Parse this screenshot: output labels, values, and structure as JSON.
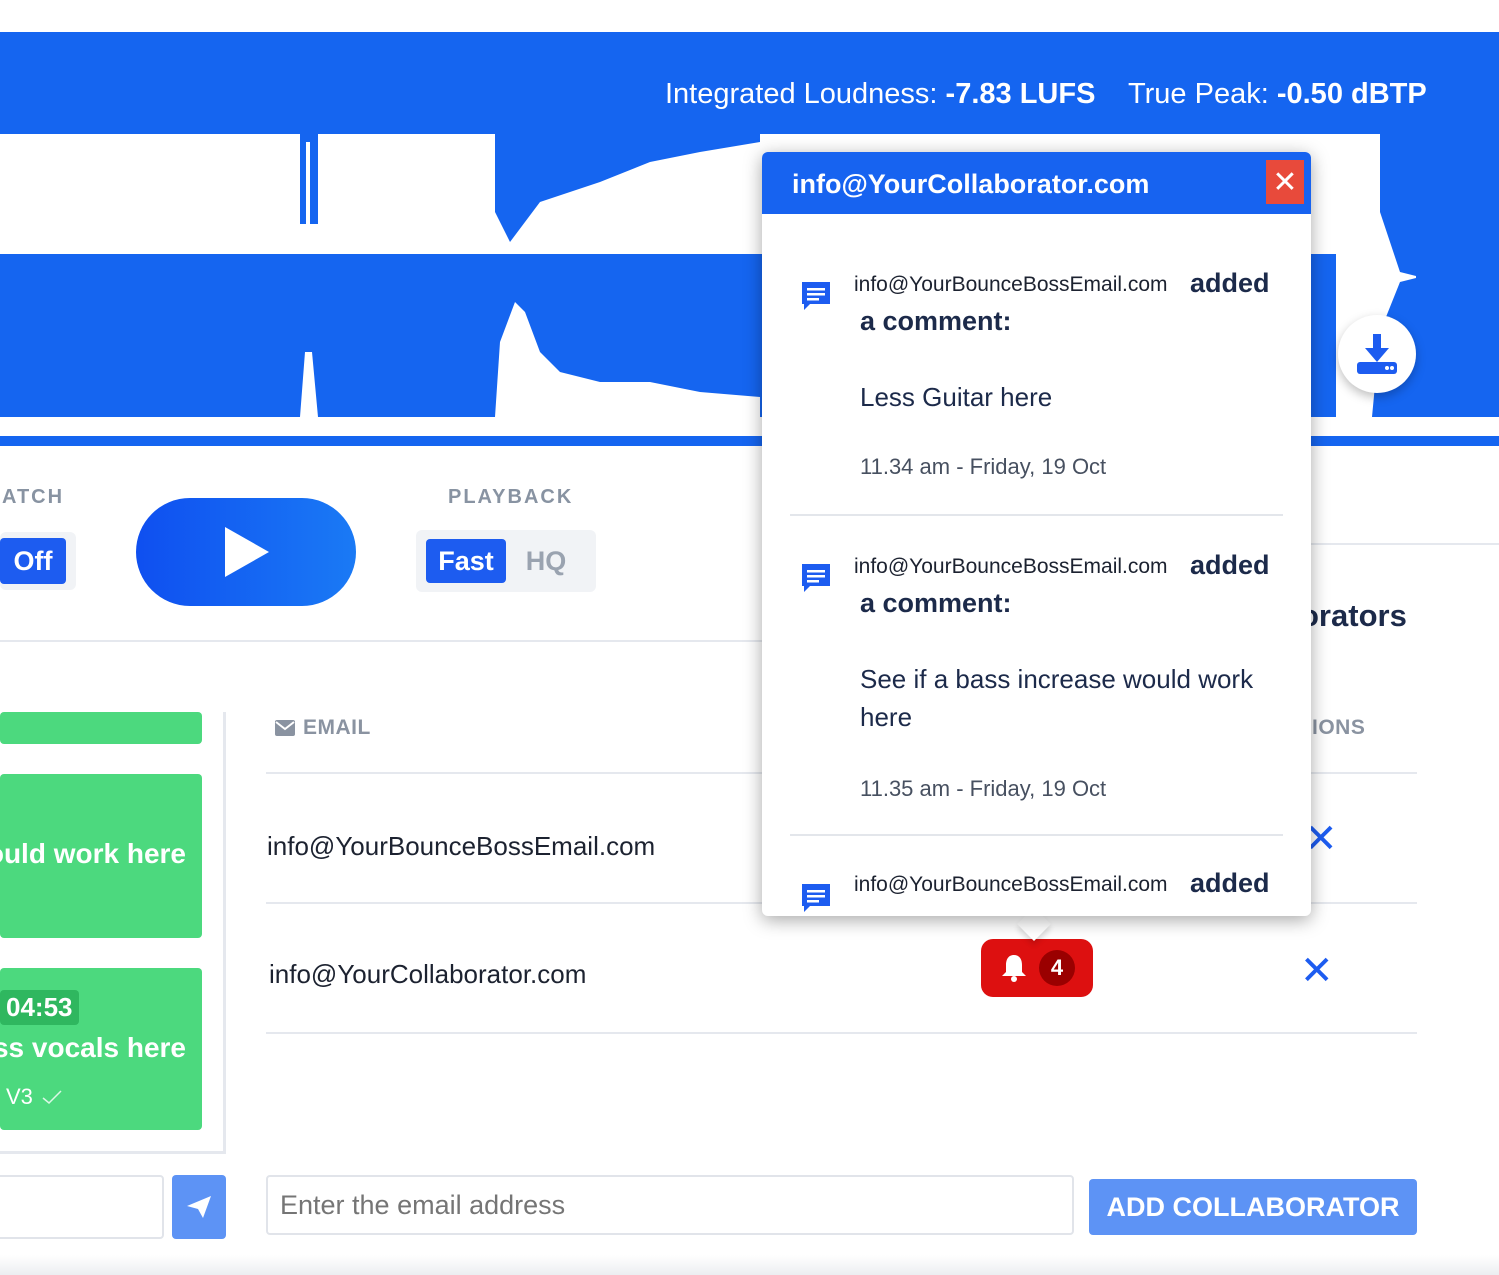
{
  "meters": {
    "loudness_label": "Integrated Loudness:",
    "loudness_value": "-7.83 LUFS",
    "peak_label": "True Peak:",
    "peak_value": "-0.50 dBTP"
  },
  "controls": {
    "match_label": "ATCH",
    "match_toggle": "Off",
    "playback_label": "PLAYBACK",
    "playback_fast": "Fast",
    "playback_hq": "HQ"
  },
  "comments_panel": {
    "cards": [
      {
        "text": "ould work here"
      },
      {
        "time": "04:53",
        "text": "ess vocals here",
        "version": "V3"
      }
    ]
  },
  "collaborators": {
    "title_partial": "orators",
    "col_email": "EMAIL",
    "col_actions": "IONS",
    "rows": [
      {
        "email": "info@YourBounceBossEmail.com"
      },
      {
        "email": "info@YourCollaborator.com",
        "notification_count": "4"
      }
    ],
    "email_placeholder": "Enter the email address",
    "add_button": "ADD COLLABORATOR"
  },
  "popup": {
    "title": "info@YourCollaborator.com",
    "close": "✕",
    "notifications": [
      {
        "author": "info@YourBounceBossEmail.com",
        "action": "added",
        "action_cont": "a comment:",
        "body": "Less Guitar here",
        "time": "11.34 am - Friday, 19 Oct"
      },
      {
        "author": "info@YourBounceBossEmail.com",
        "action": "added",
        "action_cont": "a comment:",
        "body": "See if a bass increase would work here",
        "time": "11.35 am - Friday, 19 Oct"
      },
      {
        "author": "info@YourBounceBossEmail.com",
        "action": "added"
      }
    ]
  },
  "colors": {
    "banner": "#1565f0",
    "accent": "#1d5cf0",
    "card_green": "#4cd97e",
    "badge_red": "#dd1010"
  }
}
